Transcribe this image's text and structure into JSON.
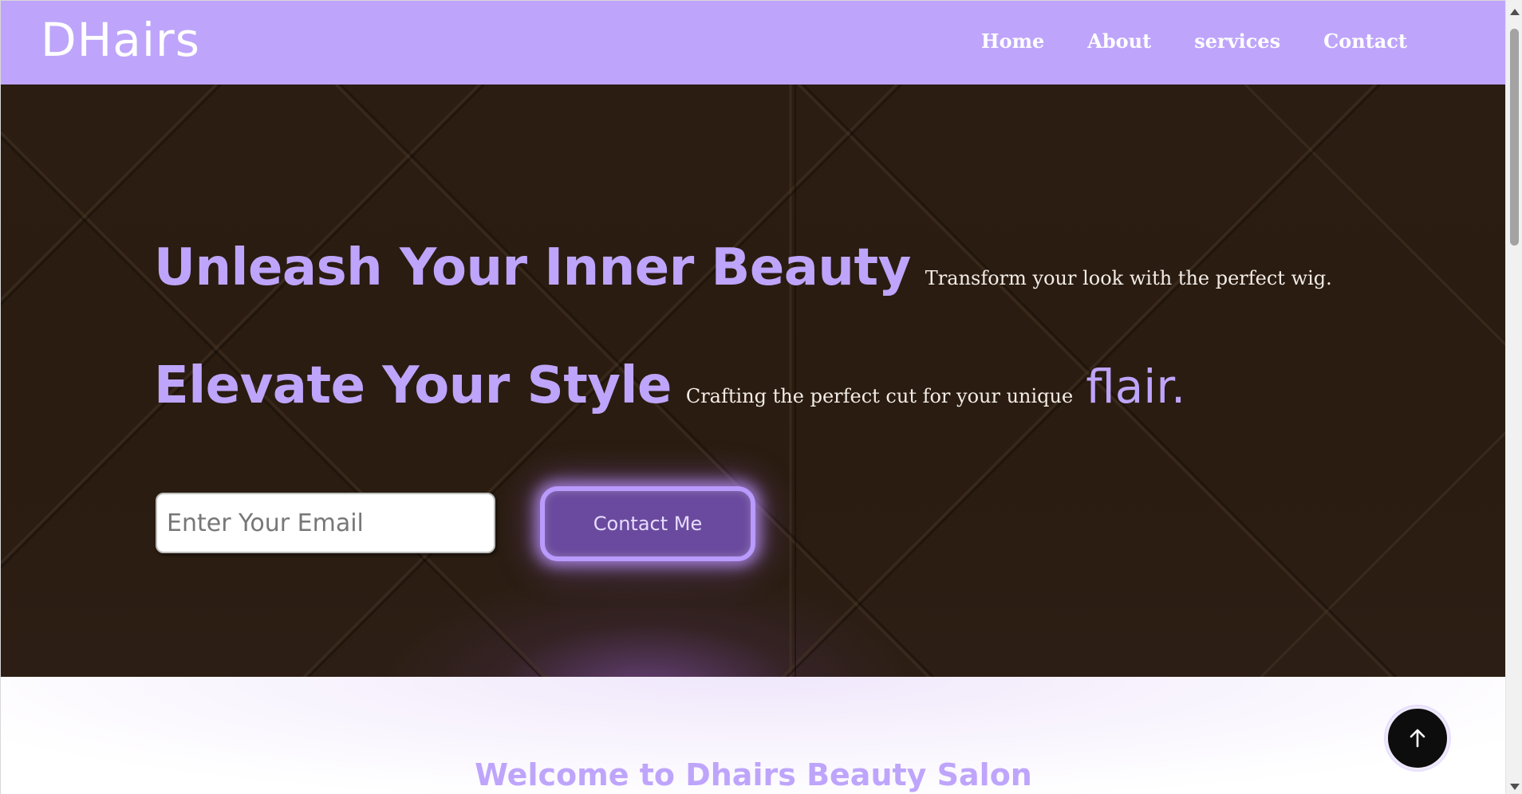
{
  "navbar": {
    "logo": "DHairs",
    "links": [
      "Home",
      "About",
      "services",
      "Contact"
    ]
  },
  "hero": {
    "headline_1": "Unleash Your Inner Beauty",
    "subline_1": "Transform your look with the perfect wig.",
    "headline_2": "Elevate Your Style",
    "subline_2": "Crafting the perfect cut for your unique",
    "flair": "flair.",
    "email_placeholder": "Enter Your Email",
    "contact_button": "Contact Me"
  },
  "welcome": {
    "title": "Welcome to Dhairs Beauty Salon"
  },
  "icons": {
    "scroll_top": "arrow-up-icon",
    "scroll_up": "triangle-up-icon",
    "scroll_down": "triangle-down-icon"
  },
  "colors": {
    "brand": "#bea5fb",
    "hero_bg": "#2b1d12",
    "button_bg": "#6a4a9e",
    "scroll_top_bg": "#0d0d0d"
  }
}
